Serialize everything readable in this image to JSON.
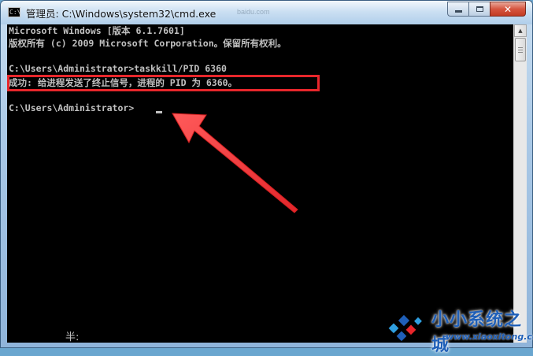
{
  "window": {
    "title": "管理员: C:\\Windows\\system32\\cmd.exe",
    "ghost_text": "baidu.com",
    "icon_label": "C:\\",
    "controls": {
      "minimize": "minimize-icon",
      "maximize": "maximize-icon",
      "close_label": "✕"
    }
  },
  "console": {
    "lines": [
      "Microsoft Windows [版本 6.1.7601]",
      "版权所有 (c) 2009 Microsoft Corporation。保留所有权利。",
      "",
      "C:\\Users\\Administrator>taskkill/PID 6360",
      "成功: 给进程发送了终止信号，进程的 PID 为 6360。",
      "",
      "C:\\Users\\Administrator>"
    ],
    "ime_status": "半:"
  },
  "annotations": {
    "highlight_color": "#e7262b",
    "arrow_color": "#ef3b3b"
  },
  "watermark": {
    "name": "小小系统之城",
    "url": "www.xiaoxitong.com"
  },
  "icons": [
    "cmd-icon",
    "minimize-icon",
    "maximize-icon",
    "close-icon",
    "scroll-up-icon",
    "arrow-annotation-icon",
    "watermark-logo-icon"
  ]
}
